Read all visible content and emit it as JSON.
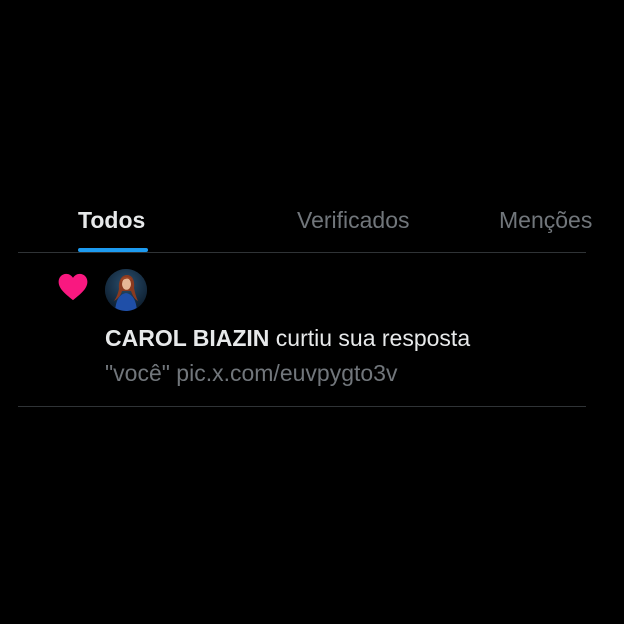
{
  "tabs": [
    {
      "label": "Todos",
      "active": true
    },
    {
      "label": "Verificados",
      "active": false
    },
    {
      "label": "Menções",
      "active": false
    }
  ],
  "notification": {
    "type_icon": "heart-icon",
    "user_name": "CAROL BIAZIN",
    "action_text": " curtiu sua resposta",
    "preview_text": "\"você\" pic.x.com/euvpygto3v"
  },
  "colors": {
    "background": "#000000",
    "accent": "#1d9bf0",
    "like": "#f91880",
    "text_primary": "#e7e9ea",
    "text_secondary": "#71767b",
    "divider": "#2f3336"
  }
}
